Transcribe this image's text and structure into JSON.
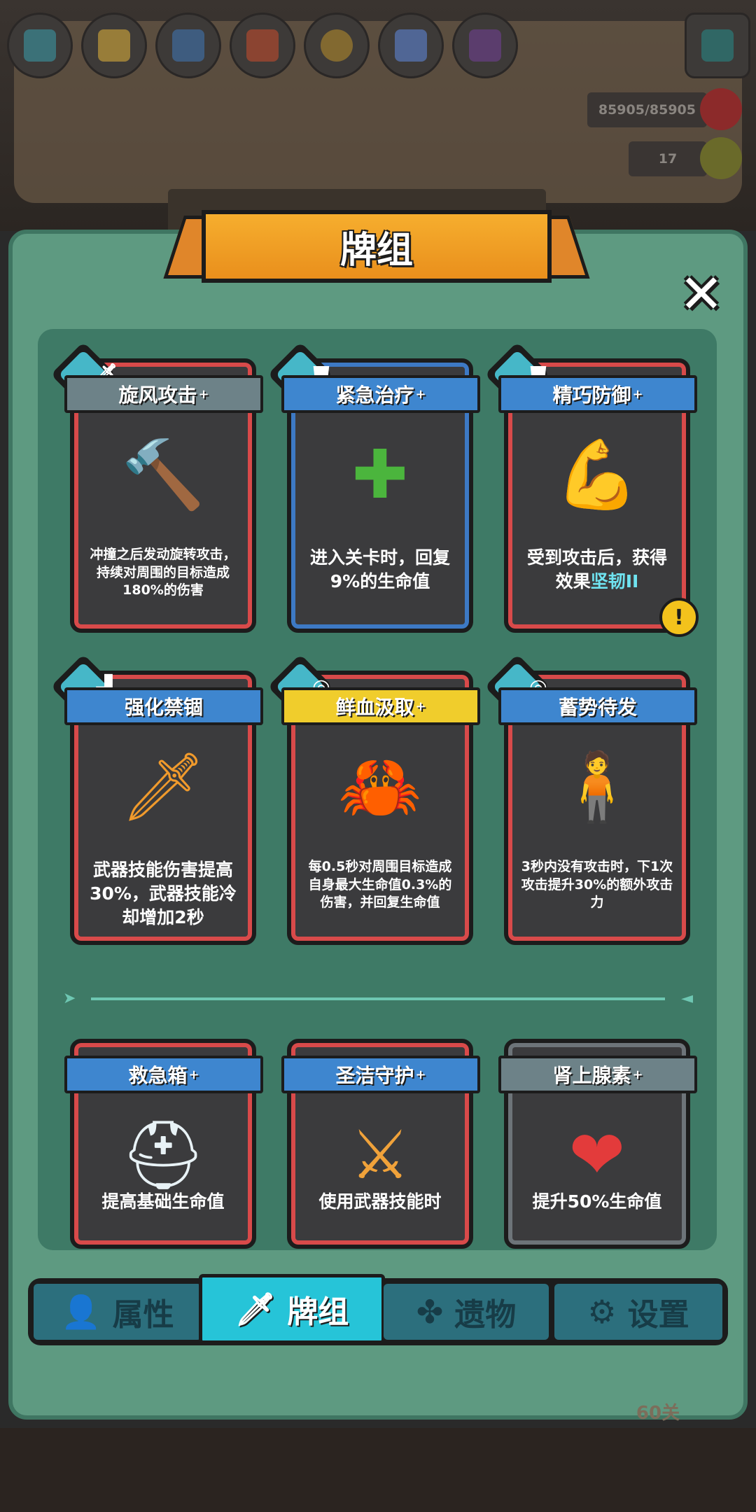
{
  "header": {
    "hp": "85905/85905",
    "currency": "17",
    "top_icons": [
      "boot-icon",
      "card-deck-icon",
      "shield-gear-icon",
      "fire-emblem-icon",
      "coin-icon",
      "crystal-icon",
      "sock-icon"
    ]
  },
  "panel": {
    "title": "牌组",
    "close_symbol": "✕"
  },
  "cards": [
    {
      "name": "旋风攻击",
      "plus": "+",
      "ribbon": "gray",
      "frame": "red",
      "badge": "sword-icon",
      "art": "spinning-hammer-icon",
      "desc": "冲撞之后发动旋转攻击，持续对周围的目标造成180%的伤害",
      "desc_size": "small"
    },
    {
      "name": "紧急治疗",
      "plus": "+",
      "ribbon": "blue",
      "frame": "blue",
      "badge": "armor-icon",
      "art": "green-cross-icon",
      "desc": "进入关卡时，回复9%的生命值",
      "desc_size": "big"
    },
    {
      "name": "精巧防御",
      "plus": "+",
      "ribbon": "blue",
      "frame": "red",
      "badge": "armor-icon",
      "art": "muscle-arm-icon",
      "desc_prefix": "受到攻击后，获得效果",
      "desc_highlight": "坚韧II",
      "desc_size": "big",
      "warning": "!"
    },
    {
      "name": "强化禁锢",
      "plus": "",
      "ribbon": "blue",
      "frame": "red",
      "badge": "boot-icon",
      "art": "chained-sword-icon",
      "desc": "武器技能伤害提高30%，武器技能冷却增加2秒",
      "desc_size": "big"
    },
    {
      "name": "鲜血汲取",
      "plus": "+",
      "ribbon": "yellow",
      "frame": "red",
      "badge": "ring-icon",
      "art": "blood-claw-icon",
      "desc": "每0.5秒对周围目标造成自身最大生命值0.3%的伤害，并回复生命值",
      "desc_size": "small"
    },
    {
      "name": "蓄势待发",
      "plus": "",
      "ribbon": "blue",
      "frame": "red",
      "badge": "ring-icon",
      "art": "blue-golem-icon",
      "desc": "3秒内没有攻击时，下1次攻击提升30%的额外攻击力",
      "desc_size": "small"
    },
    {
      "name": "救急箱",
      "plus": "+",
      "ribbon": "blue",
      "frame": "red",
      "art": "medkit-icon",
      "desc": "提高基础生命值",
      "desc_size": "big"
    },
    {
      "name": "圣洁守护",
      "plus": "+",
      "ribbon": "blue",
      "frame": "red",
      "art": "crossed-swords-shield-icon",
      "desc": "使用武器技能时",
      "desc_size": "big"
    },
    {
      "name": "肾上腺素",
      "plus": "+",
      "ribbon": "gray",
      "frame": "gray",
      "art": "pierced-heart-icon",
      "desc": "提升50%生命值",
      "desc_size": "big"
    }
  ],
  "nav": {
    "tabs": [
      {
        "label": "属性",
        "icon": "person-icon"
      },
      {
        "label": "牌组",
        "icon": "sword-icon"
      },
      {
        "label": "遗物",
        "icon": "clover-icon"
      },
      {
        "label": "设置",
        "icon": "gear-icon"
      }
    ],
    "active": "牌组"
  },
  "footer": {
    "level": "60关"
  }
}
